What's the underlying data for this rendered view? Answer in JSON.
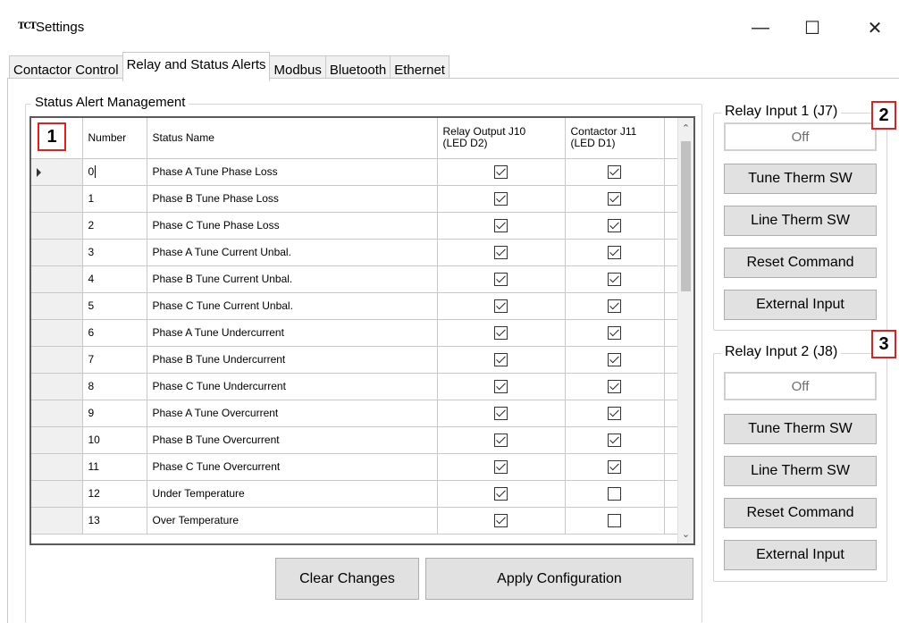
{
  "window": {
    "icon_text": "TCT",
    "title": "Settings",
    "minimize_glyph": "—",
    "maximize_glyph": "☐",
    "close_glyph": "✕"
  },
  "tabs": [
    {
      "label": "Contactor Control",
      "active": false
    },
    {
      "label": "Relay and Status Alerts",
      "active": true
    },
    {
      "label": "Modbus",
      "active": false
    },
    {
      "label": "Bluetooth",
      "active": false
    },
    {
      "label": "Ethernet",
      "active": false
    }
  ],
  "status_alerts": {
    "group_label": "Status Alert Management",
    "columns": {
      "number": "Number",
      "status_name": "Status Name",
      "relay_output": "Relay Output J10\n(LED D2)",
      "contactor": "Contactor J11\n(LED D1)"
    },
    "rows": [
      {
        "number": "0",
        "status_name": "Phase A Tune Phase Loss",
        "relay_output": true,
        "contactor": true
      },
      {
        "number": "1",
        "status_name": "Phase B Tune Phase Loss",
        "relay_output": true,
        "contactor": true
      },
      {
        "number": "2",
        "status_name": "Phase C Tune Phase Loss",
        "relay_output": true,
        "contactor": true
      },
      {
        "number": "3",
        "status_name": "Phase A Tune Current Unbal.",
        "relay_output": true,
        "contactor": true
      },
      {
        "number": "4",
        "status_name": "Phase B Tune Current Unbal.",
        "relay_output": true,
        "contactor": true
      },
      {
        "number": "5",
        "status_name": "Phase C Tune Current Unbal.",
        "relay_output": true,
        "contactor": true
      },
      {
        "number": "6",
        "status_name": "Phase A Tune Undercurrent",
        "relay_output": true,
        "contactor": true
      },
      {
        "number": "7",
        "status_name": "Phase B Tune Undercurrent",
        "relay_output": true,
        "contactor": true
      },
      {
        "number": "8",
        "status_name": "Phase C Tune Undercurrent",
        "relay_output": true,
        "contactor": true
      },
      {
        "number": "9",
        "status_name": "Phase A Tune Overcurrent",
        "relay_output": true,
        "contactor": true
      },
      {
        "number": "10",
        "status_name": "Phase B Tune Overcurrent",
        "relay_output": true,
        "contactor": true
      },
      {
        "number": "11",
        "status_name": "Phase C Tune Overcurrent",
        "relay_output": true,
        "contactor": true
      },
      {
        "number": "12",
        "status_name": "Under Temperature",
        "relay_output": true,
        "contactor": false
      },
      {
        "number": "13",
        "status_name": "Over Temperature",
        "relay_output": true,
        "contactor": false
      }
    ],
    "clear_changes_label": "Clear Changes",
    "apply_configuration_label": "Apply Configuration"
  },
  "relay_input_1": {
    "label": "Relay Input 1 (J7)",
    "status": "Off",
    "buttons": [
      "Tune Therm SW",
      "Line Therm SW",
      "Reset Command",
      "External Input"
    ]
  },
  "relay_input_2": {
    "label": "Relay Input 2 (J8)",
    "status": "Off",
    "buttons": [
      "Tune Therm SW",
      "Line Therm SW",
      "Reset Command",
      "External Input"
    ]
  },
  "markers": {
    "m1": "1",
    "m2": "2",
    "m3": "3"
  },
  "colors": {
    "marker_border": "#e02020",
    "button_bg": "#e1e1e1"
  }
}
